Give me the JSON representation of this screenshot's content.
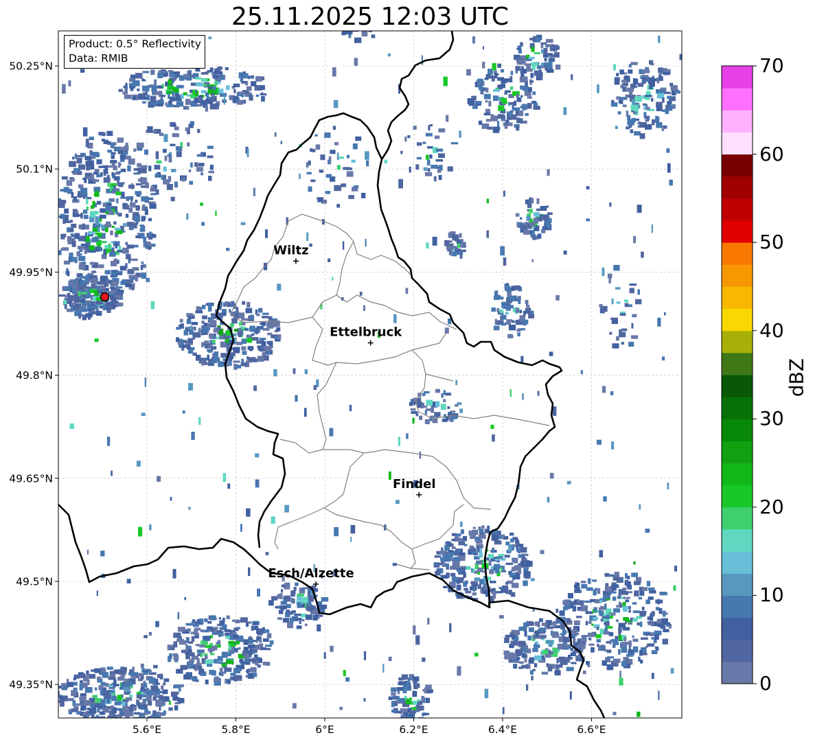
{
  "title": "25.11.2025 12:03 UTC",
  "info": {
    "product": "Product: 0.5° Reflectivity",
    "data": "Data: RMIB"
  },
  "x_ticks": [
    "5.6°E",
    "5.8°E",
    "6°E",
    "6.2°E",
    "6.4°E",
    "6.6°E"
  ],
  "y_ticks": [
    "50.25°N",
    "50.1°N",
    "49.95°N",
    "49.8°N",
    "49.65°N",
    "49.5°N",
    "49.35°N"
  ],
  "cities": [
    {
      "name": "Wiltz",
      "lon": 5.935,
      "lat": 49.966
    },
    {
      "name": "Ettelbruck",
      "lon": 6.103,
      "lat": 49.847
    },
    {
      "name": "Findel",
      "lon": 6.212,
      "lat": 49.626
    },
    {
      "name": "Esch/Alzette",
      "lon": 5.98,
      "lat": 49.496
    }
  ],
  "radar_site": {
    "lon": 5.505,
    "lat": 49.914,
    "color": "#e31a1c"
  },
  "colorbar": {
    "label": "dBZ",
    "min": 0,
    "max": 70,
    "ticks": [
      "0",
      "10",
      "20",
      "30",
      "40",
      "50",
      "60",
      "70"
    ],
    "colors": [
      "#6878a8",
      "#5066a0",
      "#4060a0",
      "#4878b0",
      "#5898c0",
      "#68c0d8",
      "#60d8c0",
      "#40d070",
      "#18c828",
      "#10b818",
      "#10a010",
      "#088808",
      "#087008",
      "#085808",
      "#407818",
      "#a8b008",
      "#f8d800",
      "#f8b800",
      "#f89800",
      "#f87800",
      "#e00000",
      "#c00000",
      "#a00000",
      "#780000",
      "#ffe0ff",
      "#ffb0ff",
      "#ff70ff",
      "#e840e8"
    ]
  },
  "colors": {
    "border": "#000000",
    "cantons": "#808080",
    "grid": "#bbbbbb"
  }
}
